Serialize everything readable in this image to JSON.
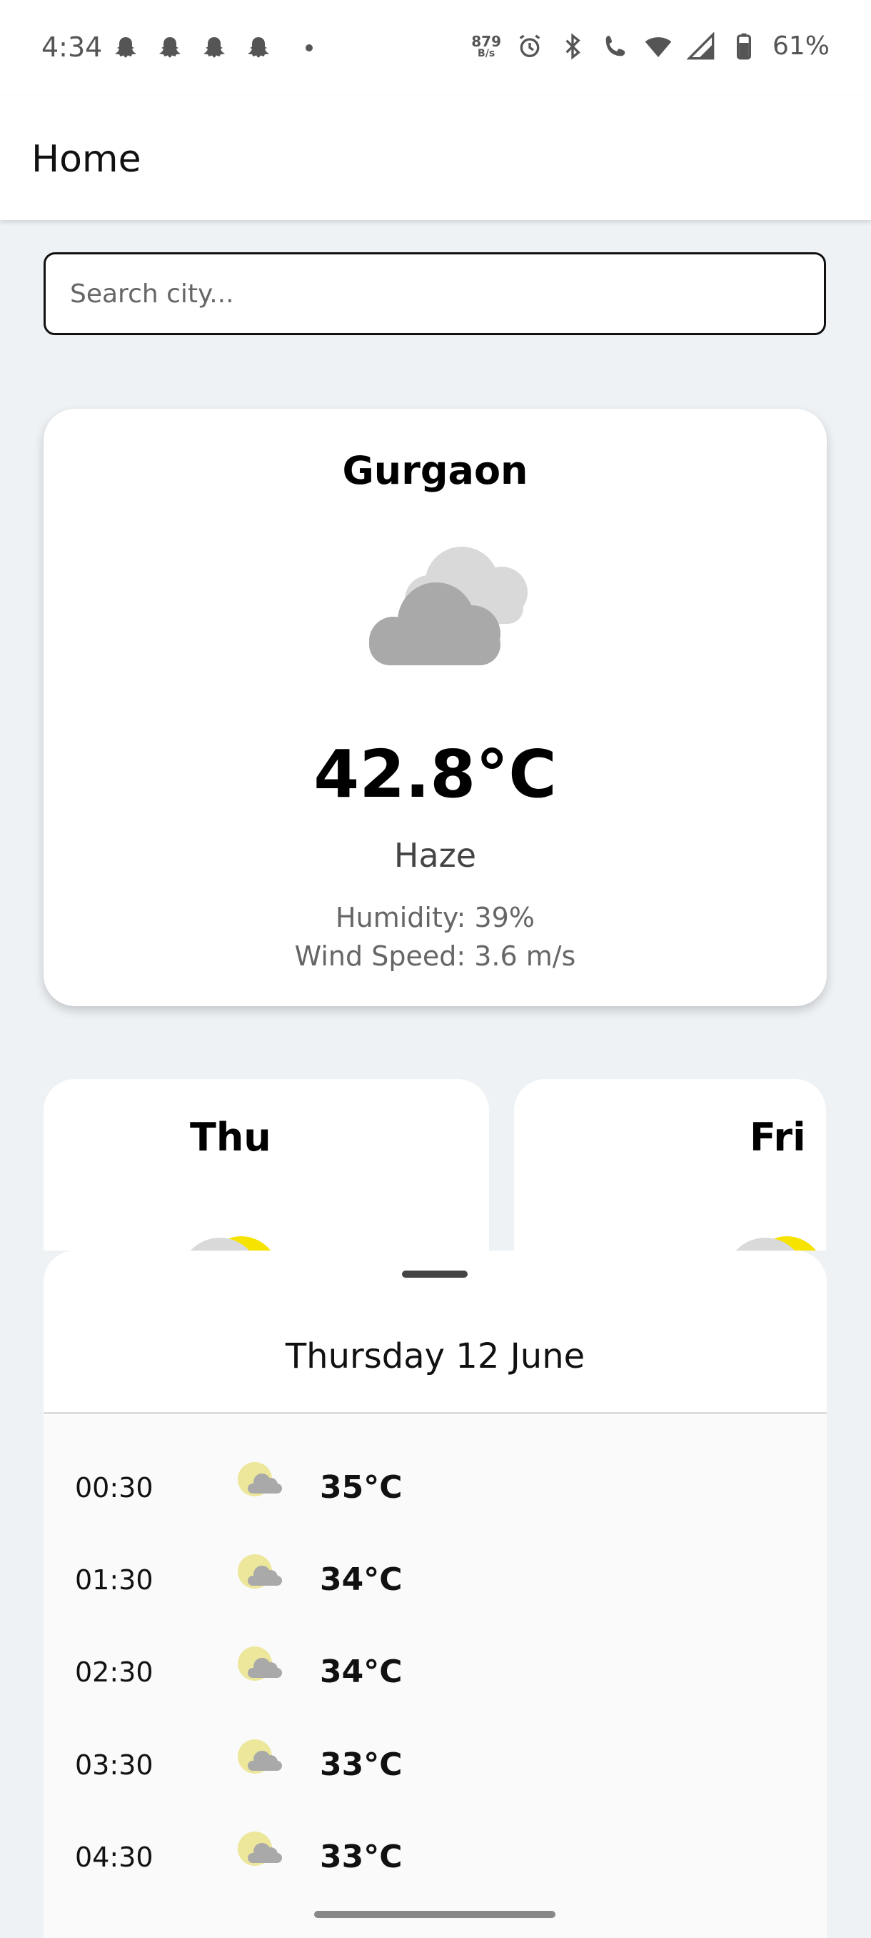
{
  "status_bar": {
    "time": "4:34",
    "net_speed_value": "879",
    "net_speed_unit": "B/s",
    "battery_percent": "61%"
  },
  "app_bar": {
    "title": "Home"
  },
  "search": {
    "placeholder": "Search city..."
  },
  "current": {
    "city": "Gurgaon",
    "temperature": "42.8°C",
    "condition": "Haze",
    "humidity": "Humidity: 39%",
    "wind": "Wind Speed: 3.6 m/s",
    "icon": "cloudy-icon"
  },
  "forecast_days": [
    {
      "day": "Thu",
      "icon": "partly-sunny-icon"
    },
    {
      "day": "Fri",
      "icon": "partly-sunny-icon"
    }
  ],
  "sheet": {
    "title": "Thursday 12 June",
    "hours": [
      {
        "time": "00:30",
        "temp": "35°C",
        "icon": "cloudy-moon-icon"
      },
      {
        "time": "01:30",
        "temp": "34°C",
        "icon": "cloudy-moon-icon"
      },
      {
        "time": "02:30",
        "temp": "34°C",
        "icon": "cloudy-moon-icon"
      },
      {
        "time": "03:30",
        "temp": "33°C",
        "icon": "cloudy-moon-icon"
      },
      {
        "time": "04:30",
        "temp": "33°C",
        "icon": "cloudy-moon-icon"
      }
    ]
  },
  "colors": {
    "background": "#eef2f5",
    "cloud_dark": "#a9a9a9",
    "cloud_light": "#d9d9d9",
    "sun_yellow": "#f7e300",
    "moon_pale": "#ece79a"
  }
}
